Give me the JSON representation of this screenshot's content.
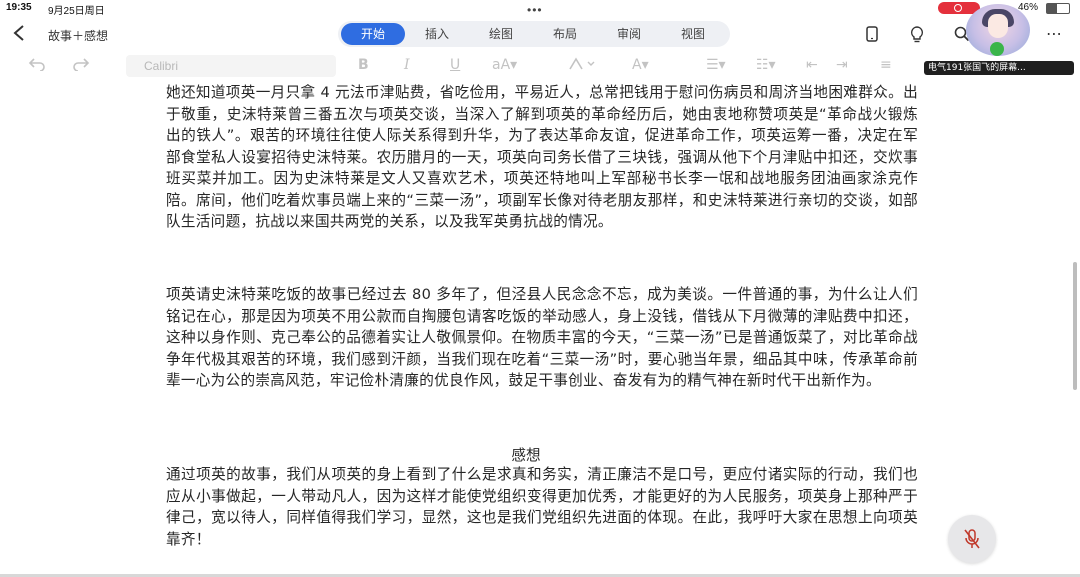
{
  "status": {
    "time": "19:35",
    "date": "9月25日周日",
    "battery": "46%",
    "battery_level": 0.46
  },
  "header": {
    "title": "故事＋感想",
    "tabs": [
      {
        "label": "开始",
        "active": true
      },
      {
        "label": "插入",
        "active": false
      },
      {
        "label": "绘图",
        "active": false
      },
      {
        "label": "布局",
        "active": false
      },
      {
        "label": "审阅",
        "active": false
      },
      {
        "label": "视图",
        "active": false
      }
    ]
  },
  "toolbar": {
    "font": "Calibri"
  },
  "call": {
    "banner": "电气191张国飞的屏幕..."
  },
  "document": {
    "para1": "她还知道项英一月只拿 4 元法币津贴费，省吃俭用，平易近人，总常把钱用于慰问伤病员和周济当地困难群众。出于敬重，史沫特莱曾三番五次与项英交谈，当深入了解到项英的革命经历后，她由衷地称赞项英是“革命战火锻炼出的铁人”。艰苦的环境往往使人际关系得到升华，为了表达革命友谊，促进革命工作，项英运筹一番，决定在军部食堂私人设宴招待史沫特莱。农历腊月的一天，项英向司务长借了三块钱，强调从他下个月津贴中扣还，交炊事班买菜并加工。因为史沫特莱是文人又喜欢艺术，项英还特地叫上军部秘书长李一氓和战地服务团油画家涂克作陪。席间，他们吃着炊事员端上来的“三菜一汤”，项副军长像对待老朋友那样，和史沫特莱进行亲切的交谈，如部队生活问题，抗战以来国共两党的关系，以及我军英勇抗战的情况。",
    "para2": "项英请史沫特莱吃饭的故事已经过去 80 多年了，但泾县人民念念不忘，成为美谈。一件普通的事，为什么让人们铭记在心，那是因为项英不用公款而自掏腰包请客吃饭的举动感人，身上没钱，借钱从下月微薄的津贴费中扣还，这种以身作则、克己奉公的品德着实让人敬佩景仰。在物质丰富的今天，“三菜一汤”已是普通饭菜了，对比革命战争年代极其艰苦的环境，我们感到汗颜，当我们现在吃着“三菜一汤”时，要心驰当年景，细品其中味，传承革命前辈一心为公的崇高风范，牢记俭朴清廉的优良作风，鼓足干事创业、奋发有为的精气神在新时代干出新作为。",
    "heading": "感想",
    "para3": "通过项英的故事，我们从项英的身上看到了什么是求真和务实，清正廉洁不是口号，更应付诸实际的行动，我们也应从小事做起，一人带动凡人，因为这样才能使党组织变得更加优秀，才能更好的为人民服务，项英身上那种严于律己，宽以待人，同样值得我们学习，显然，这也是我们党组织先进面的体现。在此，我呼吁大家在思想上向项英靠齐！"
  }
}
